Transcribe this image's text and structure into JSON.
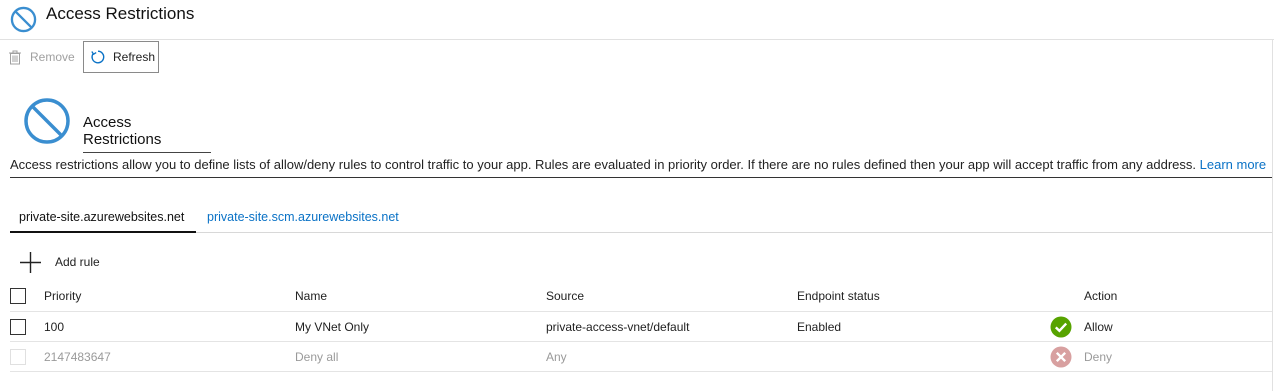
{
  "window": {
    "title": "Access Restrictions",
    "title_icon": "no-entry-icon"
  },
  "toolbar": {
    "remove_label": "Remove",
    "remove_icon": "trash-icon",
    "refresh_label": "Refresh",
    "refresh_icon": "refresh-icon"
  },
  "section": {
    "icon": "no-entry-icon",
    "title": "Access Restrictions",
    "description": "Access restrictions allow you to define lists of allow/deny rules to control traffic to your app. Rules are evaluated in priority order. If there are no rules defined then your app will accept traffic from any address.",
    "learn_more": "Learn more"
  },
  "tabs": [
    {
      "label": "private-site.azurewebsites.net",
      "active": true
    },
    {
      "label": "private-site.scm.azurewebsites.net",
      "active": false
    }
  ],
  "add_rule": {
    "label": "Add rule",
    "icon": "plus-icon"
  },
  "table": {
    "columns": {
      "priority": "Priority",
      "name": "Name",
      "source": "Source",
      "endpoint_status": "Endpoint status",
      "action": "Action"
    },
    "rows": [
      {
        "priority": "100",
        "name": "My VNet Only",
        "source": "private-access-vnet/default",
        "endpoint_status": "Enabled",
        "action": "Allow",
        "action_icon": "check-circle-icon",
        "enabled": true
      },
      {
        "priority": "2147483647",
        "name": "Deny all",
        "source": "Any",
        "endpoint_status": "",
        "action": "Deny",
        "action_icon": "x-circle-icon",
        "enabled": false
      }
    ]
  },
  "colors": {
    "link": "#0a72c6",
    "icon_blue": "#3a8ed0",
    "allow": "#57a300",
    "deny": "#d8a0a0"
  }
}
